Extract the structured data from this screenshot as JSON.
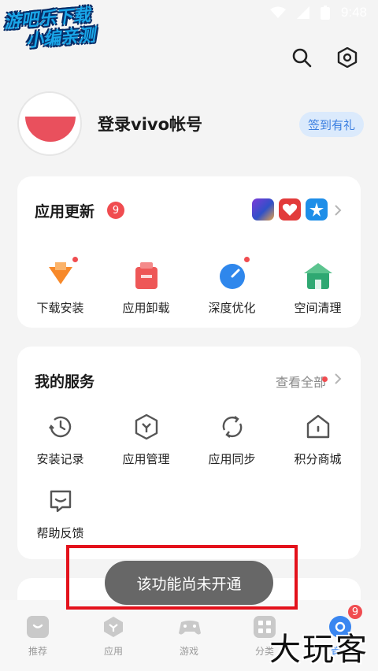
{
  "status_bar": {
    "time": "9:48",
    "icons": [
      "wifi-icon",
      "signal-icon",
      "battery-icon"
    ]
  },
  "watermark_top": {
    "line1": "游吧乐下载",
    "line2": "小编亲测"
  },
  "top_actions": {
    "icons": [
      "search-icon",
      "settings-icon"
    ]
  },
  "profile": {
    "login_text": "登录vivo帐号",
    "signin_label": "签到有礼"
  },
  "updates_card": {
    "title": "应用更新",
    "badge": "9",
    "items": [
      {
        "label": "下载安装",
        "icon": "download-icon",
        "color": "#f7892a",
        "dot": true
      },
      {
        "label": "应用卸载",
        "icon": "trash-icon",
        "color": "#ee5757",
        "dot": false
      },
      {
        "label": "深度优化",
        "icon": "gauge-icon",
        "color": "#2f87ec",
        "dot": true
      },
      {
        "label": "空间清理",
        "icon": "house-clean-icon",
        "color": "#2fa872",
        "dot": false
      }
    ]
  },
  "services_card": {
    "title": "我的服务",
    "see_all": "查看全部",
    "items": [
      {
        "label": "安装记录",
        "icon": "history-icon"
      },
      {
        "label": "应用管理",
        "icon": "app-manage-icon"
      },
      {
        "label": "应用同步",
        "icon": "sync-icon"
      },
      {
        "label": "积分商城",
        "icon": "points-mall-icon"
      },
      {
        "label": "帮助反馈",
        "icon": "feedback-icon"
      }
    ]
  },
  "toast": {
    "text": "该功能尚未开通"
  },
  "bottom_nav": {
    "items": [
      {
        "label": "推荐",
        "icon": "recommend-icon"
      },
      {
        "label": "应用",
        "icon": "apps-icon"
      },
      {
        "label": "游戏",
        "icon": "gamepad-icon"
      },
      {
        "label": "分类",
        "icon": "category-icon"
      },
      {
        "label": "管理",
        "icon": "manage-icon",
        "badge": "9"
      }
    ]
  },
  "watermark_bottom": {
    "text": "大玩客"
  }
}
